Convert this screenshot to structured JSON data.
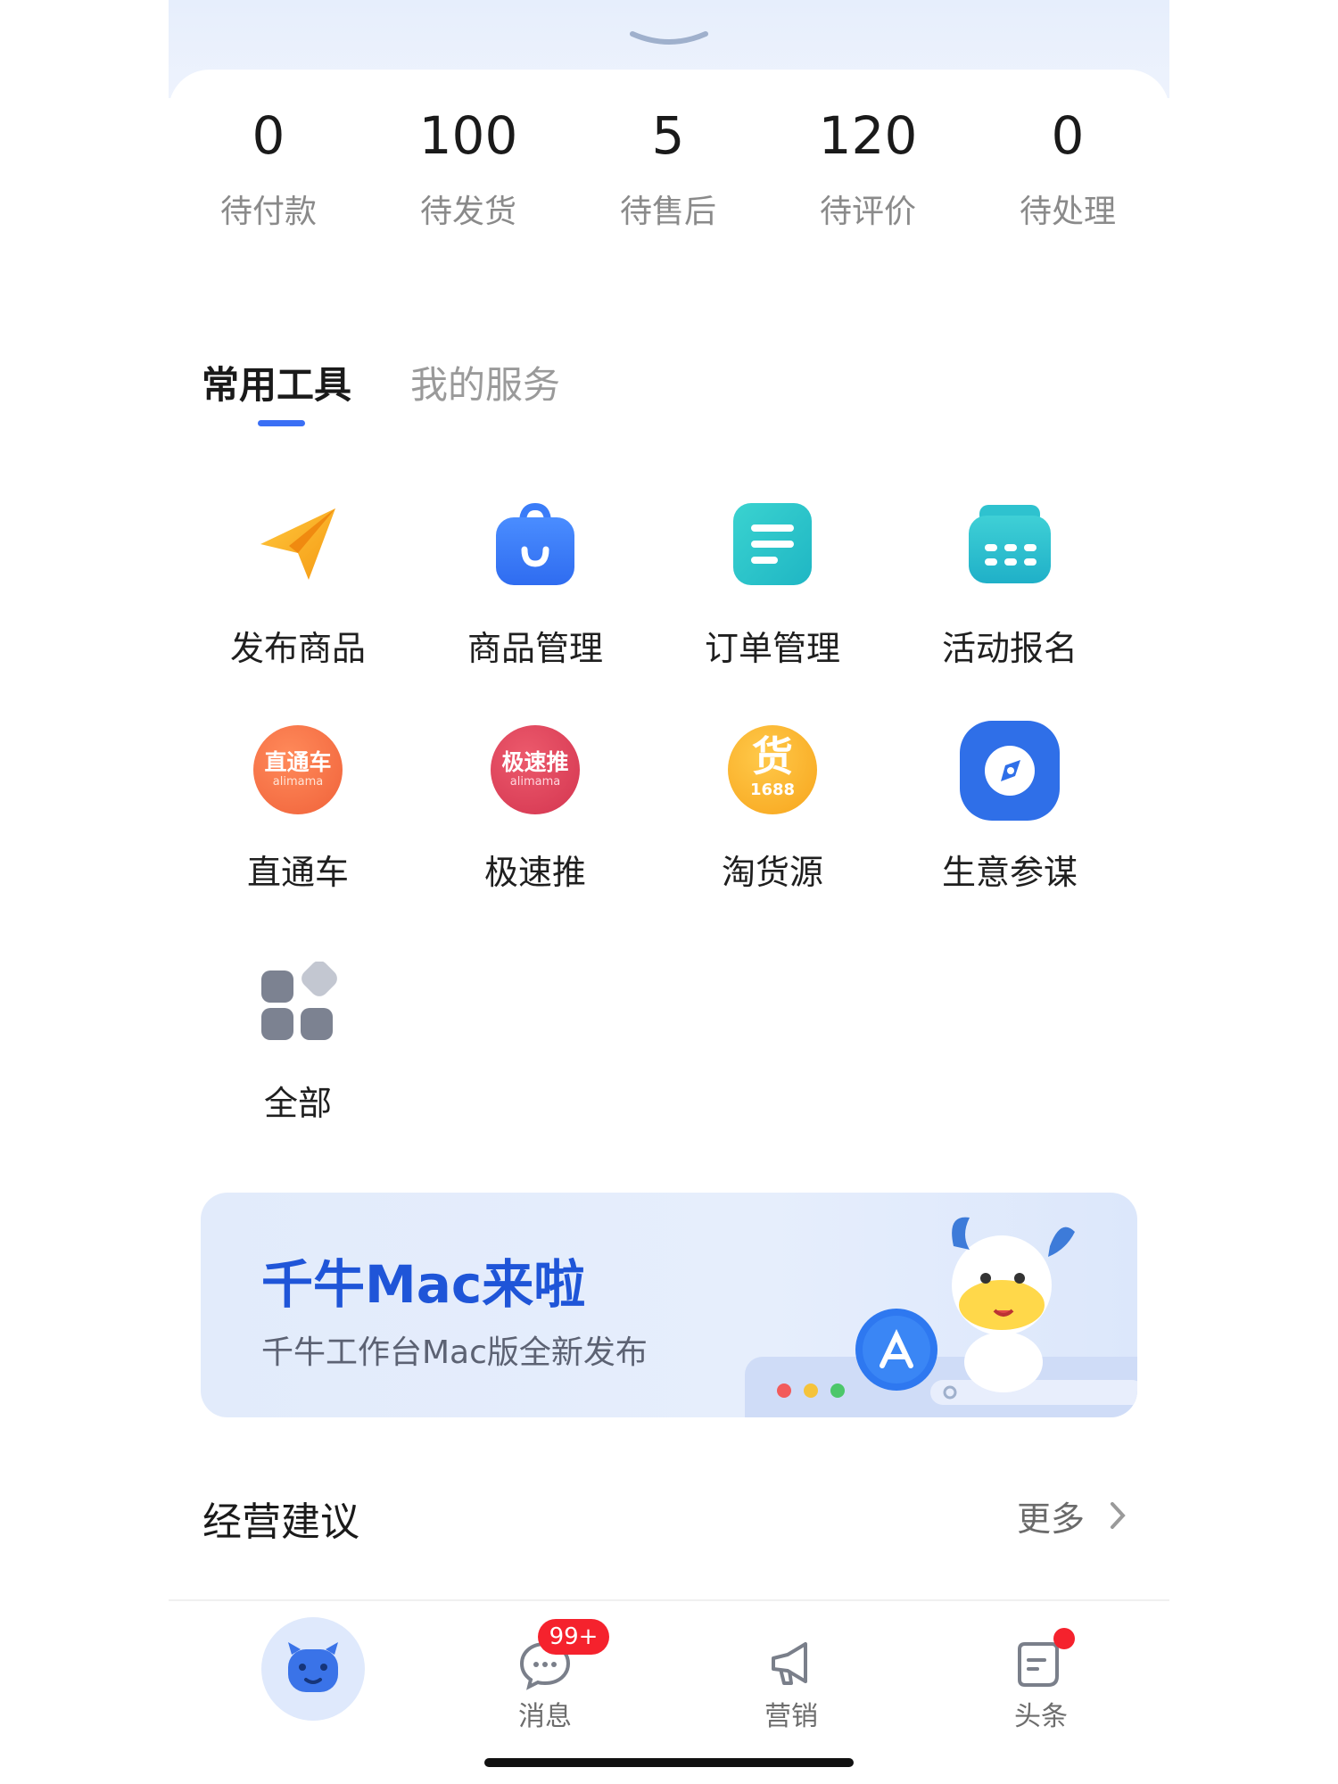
{
  "stats": [
    {
      "value": "0",
      "label": "待付款"
    },
    {
      "value": "100",
      "label": "待发货"
    },
    {
      "value": "5",
      "label": "待售后"
    },
    {
      "value": "120",
      "label": "待评价"
    },
    {
      "value": "0",
      "label": "待处理"
    }
  ],
  "tabs": {
    "tools": "常用工具",
    "services": "我的服务",
    "active": "tools"
  },
  "tools": [
    {
      "label": "发布商品",
      "icon": "paper-plane-icon"
    },
    {
      "label": "商品管理",
      "icon": "shopping-bag-icon"
    },
    {
      "label": "订单管理",
      "icon": "document-list-icon"
    },
    {
      "label": "活动报名",
      "icon": "calendar-icon"
    },
    {
      "label": "直通车",
      "icon": "ztc-logo",
      "icon_text": "直通车",
      "icon_sub": "alimama"
    },
    {
      "label": "极速推",
      "icon": "jst-logo",
      "icon_text": "极速推",
      "icon_sub": "alimama"
    },
    {
      "label": "淘货源",
      "icon": "thy-logo",
      "icon_text": "货",
      "icon_sub": "1688"
    },
    {
      "label": "生意参谋",
      "icon": "compass-icon"
    },
    {
      "label": "全部",
      "icon": "all-apps-icon"
    }
  ],
  "banner": {
    "title": "千牛Mac来啦",
    "subtitle": "千牛工作台Mac版全新发布"
  },
  "suggestions": {
    "title": "经营建议",
    "more": "更多"
  },
  "nav": {
    "messages": "消息",
    "messages_badge": "99+",
    "marketing": "营销",
    "headlines": "头条"
  },
  "colors": {
    "accent": "#3a6ff5",
    "banner_title": "#1f55d8",
    "badge": "#f5222d"
  }
}
